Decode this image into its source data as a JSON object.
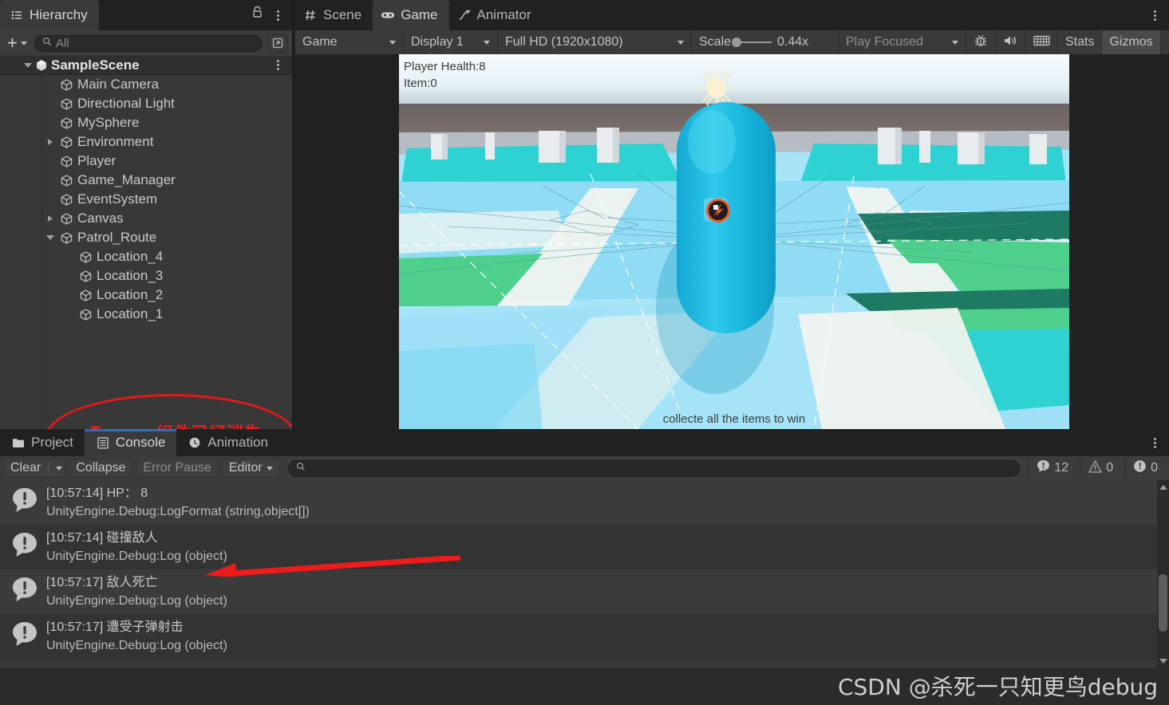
{
  "hierarchy": {
    "tab": {
      "label": "Hierarchy",
      "icon": "hierarchy-icon"
    },
    "lock_icon": "lock-icon",
    "menu_icon": "kebab-menu-icon",
    "create_label": "+",
    "search": {
      "placeholder": "All",
      "value": "",
      "icon": "search-icon"
    },
    "picker_icon": "scene-picker-icon",
    "scene": {
      "label": "SampleScene",
      "icon": "unity-scene-icon",
      "expanded": true
    },
    "items": [
      {
        "label": "Main Camera",
        "depth": 1,
        "twisty": "none",
        "icon": "gameobject-icon"
      },
      {
        "label": "Directional Light",
        "depth": 1,
        "twisty": "none",
        "icon": "gameobject-icon"
      },
      {
        "label": "MySphere",
        "depth": 1,
        "twisty": "none",
        "icon": "gameobject-icon"
      },
      {
        "label": "Environment",
        "depth": 1,
        "twisty": "collapsed",
        "icon": "gameobject-icon"
      },
      {
        "label": "Player",
        "depth": 1,
        "twisty": "none",
        "icon": "gameobject-icon"
      },
      {
        "label": "Game_Manager",
        "depth": 1,
        "twisty": "none",
        "icon": "gameobject-icon"
      },
      {
        "label": "EventSystem",
        "depth": 1,
        "twisty": "none",
        "icon": "gameobject-icon"
      },
      {
        "label": "Canvas",
        "depth": 1,
        "twisty": "collapsed",
        "icon": "gameobject-icon"
      },
      {
        "label": "Patrol_Route",
        "depth": 1,
        "twisty": "expanded",
        "icon": "gameobject-icon"
      },
      {
        "label": "Location_4",
        "depth": 2,
        "twisty": "none",
        "icon": "gameobject-icon"
      },
      {
        "label": "Location_3",
        "depth": 2,
        "twisty": "none",
        "icon": "gameobject-icon"
      },
      {
        "label": "Location_2",
        "depth": 2,
        "twisty": "none",
        "icon": "gameobject-icon"
      },
      {
        "label": "Location_1",
        "depth": 2,
        "twisty": "none",
        "icon": "gameobject-icon"
      }
    ],
    "annotation": {
      "text": "Enemy组件已经消失",
      "color": "#ed1c1c",
      "shape": "ellipse"
    }
  },
  "gameview": {
    "tabs": [
      {
        "label": "Scene",
        "icon": "scene-grid-icon",
        "active": false
      },
      {
        "label": "Game",
        "icon": "gamepad-icon",
        "active": true
      },
      {
        "label": "Animator",
        "icon": "animator-icon",
        "active": false
      }
    ],
    "menu_icon": "kebab-menu-icon",
    "toolbar": {
      "view_mode": "Game",
      "display": "Display 1",
      "resolution": "Full HD (1920x1080)",
      "scale_label": "Scale",
      "scale_value": "0.44x",
      "play_mode": "Play Focused",
      "mute_icon": "mute-audio-icon",
      "debug_icon": "frame-debug-icon",
      "stats_icon": "render-stats-icon",
      "stats_label": "Stats",
      "gizmos_label": "Gizmos"
    },
    "hud": {
      "health": "Player Health:8",
      "item": "Item:0",
      "objective": "collecte all the items to win"
    },
    "scene_colors": {
      "sky_top": "#f3fafd",
      "sky_band": "#cfd6d9",
      "ground_far": "#6a5f5c",
      "floor": "#a5e3f7",
      "water_cyan": "#2ad4d4",
      "grass_green": "#4cd08a",
      "grass_dark": "#1f7a63",
      "player": "#16b9e0",
      "path": "#f3f4ef",
      "sun": "#f7f0cc",
      "gizmo_orange": "#f05a28"
    }
  },
  "console": {
    "tabs": [
      {
        "label": "Project",
        "icon": "folder-icon",
        "active": false
      },
      {
        "label": "Console",
        "icon": "console-icon",
        "active": true
      },
      {
        "label": "Animation",
        "icon": "clock-icon",
        "active": false
      }
    ],
    "menu_icon": "kebab-menu-icon",
    "toolbar": {
      "clear_label": "Clear",
      "collapse_label": "Collapse",
      "error_pause_label": "Error Pause",
      "editor_label": "Editor",
      "search": {
        "placeholder": "",
        "value": "",
        "icon": "search-icon"
      }
    },
    "counters": [
      {
        "icon": "log-icon",
        "count": "12"
      },
      {
        "icon": "warning-icon",
        "count": "0"
      },
      {
        "icon": "error-icon",
        "count": "0"
      }
    ],
    "entries": [
      {
        "icon": "log-icon",
        "line1": "[10:57:14] HP： 8",
        "line2": "UnityEngine.Debug:LogFormat (string,object[])"
      },
      {
        "icon": "log-icon",
        "line1": "[10:57:14] 碰撞敌人",
        "line2": "UnityEngine.Debug:Log (object)"
      },
      {
        "icon": "log-icon",
        "line1": "[10:57:17] 敌人死亡",
        "line2": "UnityEngine.Debug:Log (object)"
      },
      {
        "icon": "log-icon",
        "line1": "[10:57:17] 遭受子弹射击",
        "line2": "UnityEngine.Debug:Log (object)"
      }
    ],
    "arrow_annotation": {
      "points_to_row": 3,
      "color": "#ee1b1b"
    }
  },
  "watermark": {
    "text": "CSDN @杀死一只知更鸟debug"
  }
}
